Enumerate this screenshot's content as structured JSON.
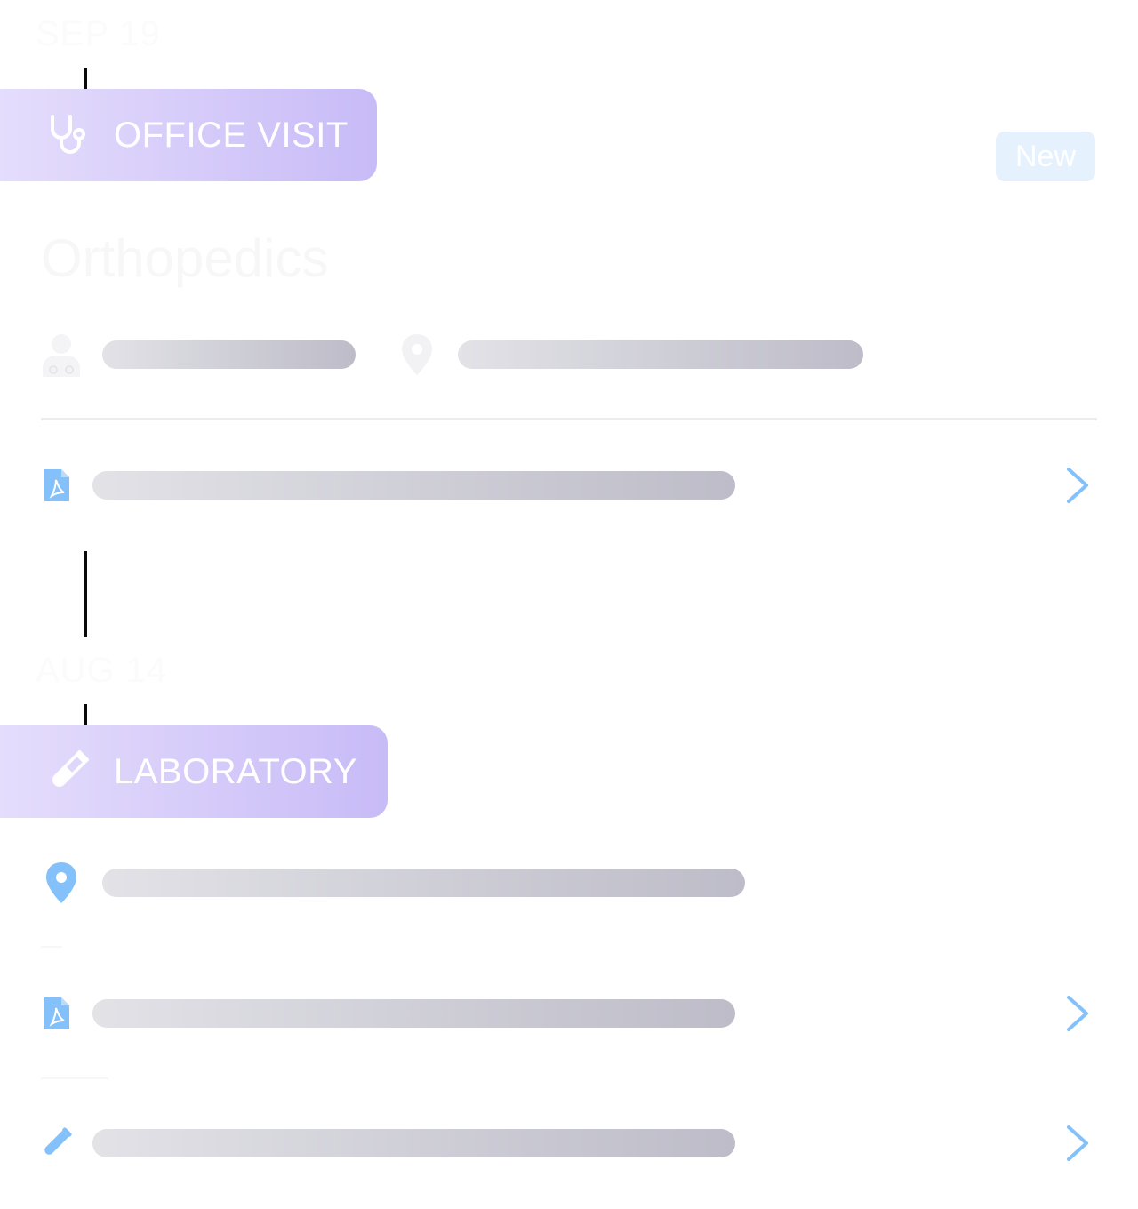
{
  "entries": [
    {
      "date": "SEP 19",
      "type_label": "OFFICE VISIT",
      "badge": "New",
      "specialty": "Orthopedics",
      "icons": {
        "type": "stethoscope-icon",
        "provider": "doctor-icon",
        "location": "location-pin-icon",
        "document": "pdf-file-icon",
        "chevron": "chevron-right-icon"
      }
    },
    {
      "date": "AUG 14",
      "type_label": "LABORATORY",
      "icons": {
        "type": "test-tube-icon",
        "location": "location-pin-icon",
        "document": "pdf-file-icon",
        "lab_result": "test-tube-icon",
        "chevron": "chevron-right-icon"
      }
    }
  ],
  "colors": {
    "tag_gradient_start": "#e5ddfc",
    "tag_gradient_end": "#c8bbf7",
    "accent_blue": "#84c1fa",
    "skeleton_start": "#e2e2e7",
    "skeleton_end": "#bdbcc8",
    "badge_bg": "#e6f1fe"
  }
}
